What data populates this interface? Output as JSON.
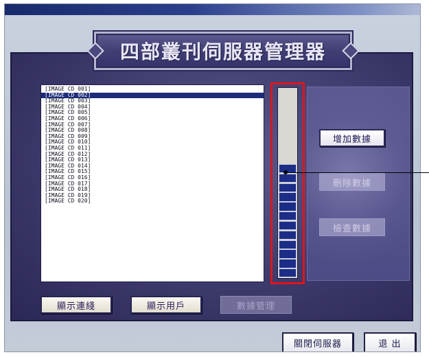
{
  "app": {
    "title": "四部叢刊伺服器管理器"
  },
  "image_list": {
    "selected_index": 1,
    "items": [
      "[IMAGE CD 001]",
      "[IMAGE CD 002]",
      "[IMAGE CD 003]",
      "[IMAGE CD 004]",
      "[IMAGE CD 005]",
      "[IMAGE CD 006]",
      "[IMAGE CD 007]",
      "[IMAGE CD 008]",
      "[IMAGE CD 009]",
      "[IMAGE CD 010]",
      "[IMAGE CD 011]",
      "[IMAGE CD 012]",
      "[IMAGE CD 013]",
      "[IMAGE CD 014]",
      "[IMAGE CD 015]",
      "[IMAGE CD 016]",
      "[IMAGE CD 017]",
      "[IMAGE CD 018]",
      "[IMAGE CD 019]",
      "[IMAGE CD 020]"
    ]
  },
  "meter": {
    "filled_segments": 12,
    "total_segments": 20,
    "fill_color": "#1b2d86",
    "highlight_color": "#e0141a"
  },
  "side_buttons": {
    "add_data": "增加數據",
    "remove_data": "刪除數據",
    "check_data": "檢查數據"
  },
  "bottom_buttons": {
    "show_connections": "顯示連綫",
    "show_users": "顯示用戶",
    "data_management": "數據管理"
  },
  "footer_buttons": {
    "close_server": "關閉伺服器",
    "exit": "退 出"
  },
  "colors": {
    "panel": "#3d3a6c",
    "title_bar": "#182a6b",
    "selection": "#1c2b7a"
  }
}
